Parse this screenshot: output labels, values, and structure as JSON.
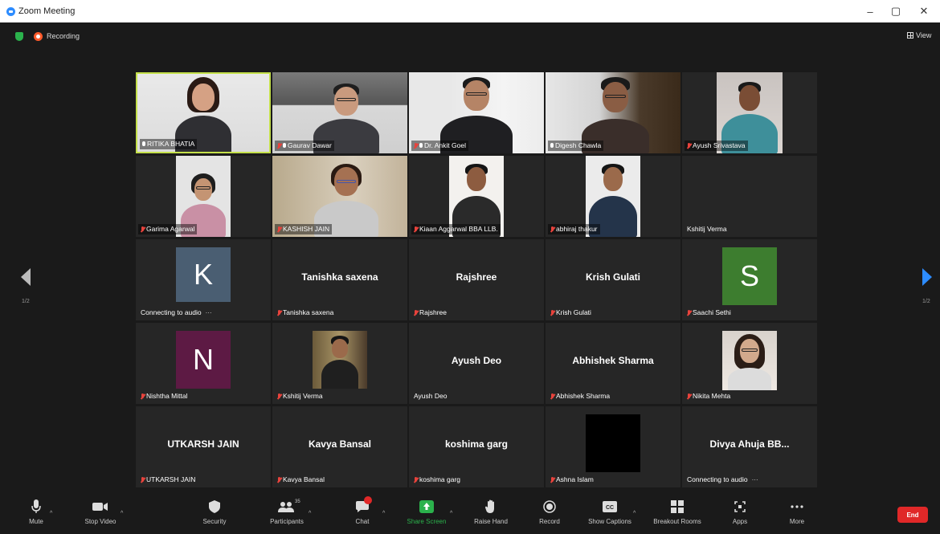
{
  "window": {
    "title": "Zoom Meeting",
    "controls": [
      "–",
      "▢",
      "✕"
    ]
  },
  "top": {
    "recording_label": "Recording",
    "view_label": "View"
  },
  "pagination": {
    "left": "1/2",
    "right": "1/2"
  },
  "tiles": [
    {
      "name": "RITIKA BHATIA",
      "muted": false,
      "video": "ritika",
      "active": true
    },
    {
      "name": "Gaurav Dawar",
      "muted": true,
      "video": "gaurav"
    },
    {
      "name": "Dr. Ankit Goel",
      "muted": true,
      "video": "ankit"
    },
    {
      "name": "Digesh Chawla",
      "muted": false,
      "video": "digesh"
    },
    {
      "name": "Ayush Srivastava",
      "muted": true,
      "video": "ayush_s"
    },
    {
      "name": "Garima Agarwal",
      "muted": true,
      "video": "garima"
    },
    {
      "name": "KASHISH JAIN",
      "muted": true,
      "video": "kashish"
    },
    {
      "name": "Kiaan Aggarwal BBA LLB.",
      "muted": true,
      "video": "kiaan"
    },
    {
      "name": "abhiraj thakur",
      "muted": true,
      "video": "abhiraj"
    },
    {
      "name": "Kshitij Verma",
      "muted": null,
      "video": "none"
    },
    {
      "name": "Connecting to audio",
      "avatar_letter": "K",
      "avatar_color": "#4a5e72",
      "video": "avatar"
    },
    {
      "name": "Tanishka saxena",
      "muted": true,
      "big": "Tanishka saxena"
    },
    {
      "name": "Rajshree",
      "muted": true,
      "big": "Rajshree"
    },
    {
      "name": "Krish Gulati",
      "muted": true,
      "big": "Krish Gulati"
    },
    {
      "name": "Saachi Sethi",
      "muted": true,
      "avatar_letter": "S",
      "avatar_color": "#3d7d2f",
      "video": "avatar"
    },
    {
      "name": "Nishtha Mittal",
      "muted": true,
      "avatar_letter": "N",
      "avatar_color": "#5d1a44",
      "video": "avatar"
    },
    {
      "name": "Kshitij Verma",
      "muted": true,
      "video": "kshitij"
    },
    {
      "name": "Ayush Deo",
      "muted": null,
      "big": "Ayush Deo"
    },
    {
      "name": "Abhishek Sharma",
      "muted": true,
      "big": "Abhishek Sharma"
    },
    {
      "name": "Nikita Mehta",
      "muted": true,
      "video": "nikita"
    },
    {
      "name": "UTKARSH JAIN",
      "muted": true,
      "big": "UTKARSH JAIN"
    },
    {
      "name": "Kavya Bansal",
      "muted": true,
      "big": "Kavya Bansal"
    },
    {
      "name": "koshima garg",
      "muted": true,
      "big": "koshima garg"
    },
    {
      "name": "Ashna Islam",
      "muted": true,
      "video": "black"
    },
    {
      "name": "Connecting to audio",
      "big": "Divya Ahuja BB..."
    }
  ],
  "toolbar": {
    "mute": "Mute",
    "stop_video": "Stop Video",
    "security": "Security",
    "participants": "Participants",
    "participants_count": "35",
    "chat": "Chat",
    "share_screen": "Share Screen",
    "raise_hand": "Raise Hand",
    "record": "Record",
    "show_captions": "Show Captions",
    "breakout_rooms": "Breakout Rooms",
    "apps": "Apps",
    "more": "More",
    "end": "End"
  },
  "colors": {
    "accent": "#2d8cff",
    "share": "#2bb24c",
    "end": "#e02828",
    "active_speaker": "#c4e04a"
  }
}
